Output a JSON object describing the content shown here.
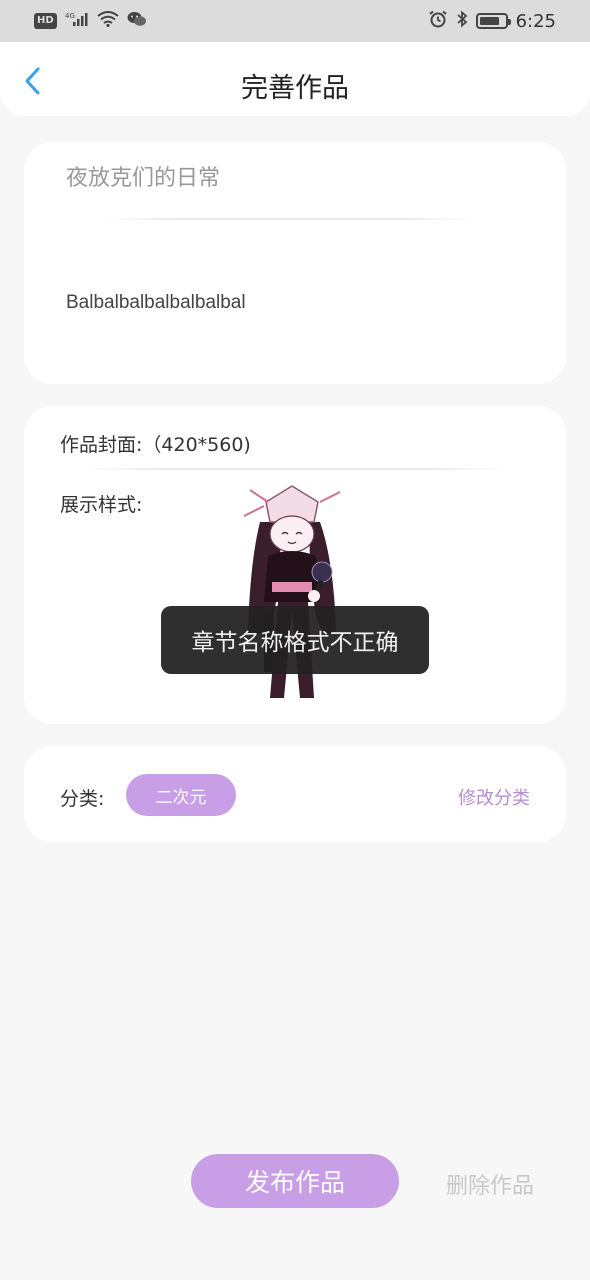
{
  "status_bar": {
    "hd_badge": "HD",
    "network": "4G",
    "signal_icon": "signal-icon",
    "wifi_icon": "wifi-icon",
    "wechat_icon": "wechat-icon",
    "alarm_icon": "alarm-icon",
    "bluetooth_icon": "bluetooth-icon",
    "battery_level": 0.8,
    "time": "6:25"
  },
  "header": {
    "back_icon": "chevron-left-icon",
    "title": "完善作品"
  },
  "title_card": {
    "title_value": "夜放克们的日常",
    "description_value": "Balbalbalbalbalbalbal"
  },
  "cover_card": {
    "cover_label": "作品封面:（420*560)",
    "style_label": "展示样式:"
  },
  "category_card": {
    "label": "分类:",
    "selected_category": "二次元",
    "edit_link": "修改分类"
  },
  "toast": {
    "message": "章节名称格式不正确"
  },
  "actions": {
    "publish_label": "发布作品",
    "delete_label": "删除作品"
  },
  "colors": {
    "accent": "#c89ee6",
    "link": "#b88ad8",
    "disabled_text": "#c8c8c8",
    "toast_bg": "#222222",
    "status_bar_bg": "#dcdcdc",
    "page_bg": "#f7f7f7"
  }
}
